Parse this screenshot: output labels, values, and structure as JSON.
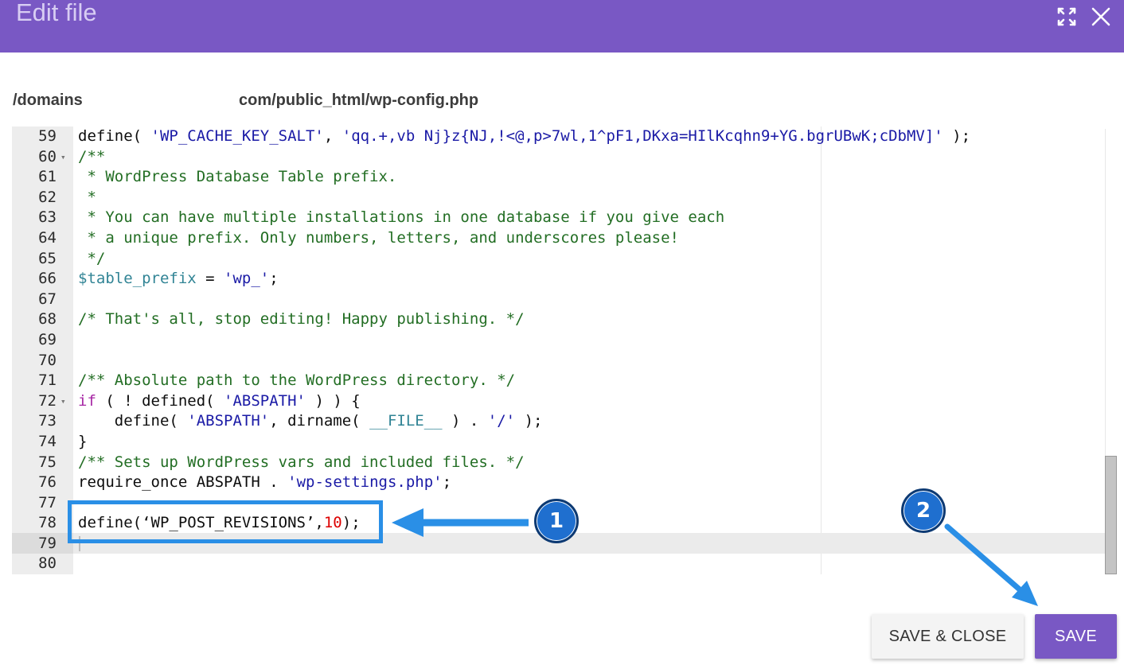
{
  "dialog": {
    "title": "Edit file",
    "path_prefix": "/domains",
    "path_suffix": "com/public_html/wp-config.php"
  },
  "colors": {
    "header": "#7958c4",
    "save_button": "#7958c4",
    "annotation": "#2a8fe6",
    "badge": "#1f6fcf"
  },
  "icons": {
    "expand": "expand-icon",
    "close": "close-icon"
  },
  "editor": {
    "active_line": "79",
    "lines": [
      {
        "num": "59",
        "fold": "",
        "tokens": [
          {
            "t": "define( ",
            "c": "t-def"
          },
          {
            "t": "'WP_CACHE_KEY_SALT'",
            "c": "t-str"
          },
          {
            "t": ", ",
            "c": "t-def"
          },
          {
            "t": "'qq.+,vb Nj}z{NJ,!<@,p>7wl,1^pF1,DKxa=HIlKcqhn9+YG.bgrUBwK;cDbMV]'",
            "c": "t-str"
          },
          {
            "t": " );",
            "c": "t-def"
          }
        ]
      },
      {
        "num": "60",
        "fold": "▾",
        "tokens": [
          {
            "t": "/**",
            "c": "t-com"
          }
        ]
      },
      {
        "num": "61",
        "fold": "",
        "tokens": [
          {
            "t": " * WordPress Database Table prefix.",
            "c": "t-com"
          }
        ]
      },
      {
        "num": "62",
        "fold": "",
        "tokens": [
          {
            "t": " *",
            "c": "t-com"
          }
        ]
      },
      {
        "num": "63",
        "fold": "",
        "tokens": [
          {
            "t": " * You can have multiple installations in one database if you give each",
            "c": "t-com"
          }
        ]
      },
      {
        "num": "64",
        "fold": "",
        "tokens": [
          {
            "t": " * a unique prefix. Only numbers, letters, and underscores please!",
            "c": "t-com"
          }
        ]
      },
      {
        "num": "65",
        "fold": "",
        "tokens": [
          {
            "t": " */",
            "c": "t-com"
          }
        ]
      },
      {
        "num": "66",
        "fold": "",
        "tokens": [
          {
            "t": "$table_prefix",
            "c": "t-var"
          },
          {
            "t": " = ",
            "c": "t-def"
          },
          {
            "t": "'wp_'",
            "c": "t-str"
          },
          {
            "t": ";",
            "c": "t-def"
          }
        ]
      },
      {
        "num": "67",
        "fold": "",
        "tokens": []
      },
      {
        "num": "68",
        "fold": "",
        "tokens": [
          {
            "t": "/* That's all, stop editing! Happy publishing. */",
            "c": "t-com"
          }
        ]
      },
      {
        "num": "69",
        "fold": "",
        "tokens": []
      },
      {
        "num": "70",
        "fold": "",
        "tokens": []
      },
      {
        "num": "71",
        "fold": "",
        "tokens": [
          {
            "t": "/** Absolute path to the WordPress directory. */",
            "c": "t-com"
          }
        ]
      },
      {
        "num": "72",
        "fold": "▾",
        "tokens": [
          {
            "t": "if",
            "c": "t-kw"
          },
          {
            "t": " ( ! defined( ",
            "c": "t-def"
          },
          {
            "t": "'ABSPATH'",
            "c": "t-str"
          },
          {
            "t": " ) ) {",
            "c": "t-def"
          }
        ]
      },
      {
        "num": "73",
        "fold": "",
        "tokens": [
          {
            "t": "    define( ",
            "c": "t-def"
          },
          {
            "t": "'ABSPATH'",
            "c": "t-str"
          },
          {
            "t": ", dirname( ",
            "c": "t-def"
          },
          {
            "t": "__FILE__",
            "c": "t-cst"
          },
          {
            "t": " ) . ",
            "c": "t-def"
          },
          {
            "t": "'/'",
            "c": "t-str"
          },
          {
            "t": " );",
            "c": "t-def"
          }
        ]
      },
      {
        "num": "74",
        "fold": "",
        "tokens": [
          {
            "t": "}",
            "c": "t-def"
          }
        ]
      },
      {
        "num": "75",
        "fold": "",
        "tokens": [
          {
            "t": "/** Sets up WordPress vars and included files. */",
            "c": "t-com"
          }
        ]
      },
      {
        "num": "76",
        "fold": "",
        "tokens": [
          {
            "t": "require_once",
            "c": "t-def"
          },
          {
            "t": " ABSPATH . ",
            "c": "t-def"
          },
          {
            "t": "'wp-settings.php'",
            "c": "t-str"
          },
          {
            "t": ";",
            "c": "t-def"
          }
        ]
      },
      {
        "num": "77",
        "fold": "",
        "tokens": []
      },
      {
        "num": "78",
        "fold": "",
        "tokens": [
          {
            "t": "define(‘WP_POST_REVISIONS’,",
            "c": "t-def"
          },
          {
            "t": "10",
            "c": "t-num"
          },
          {
            "t": ");",
            "c": "t-def"
          }
        ]
      },
      {
        "num": "79",
        "fold": "",
        "tokens": []
      },
      {
        "num": "80",
        "fold": "",
        "tokens": []
      }
    ]
  },
  "annotations": {
    "badge_1": "1",
    "badge_2": "2"
  },
  "buttons": {
    "save_close": "SAVE & CLOSE",
    "save": "SAVE"
  }
}
